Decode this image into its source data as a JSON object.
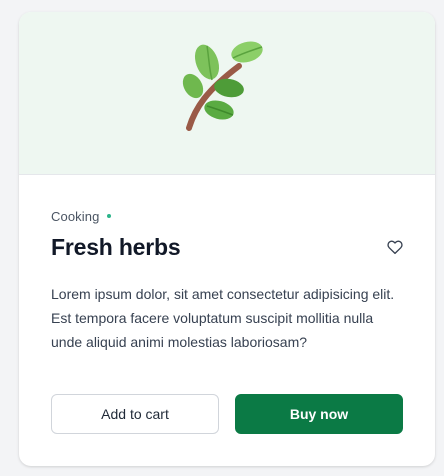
{
  "card": {
    "category": "Cooking",
    "title": "Fresh herbs",
    "description": "Lorem ipsum dolor, sit amet consectetur adipisicing elit. Est tempora facere voluptatum suscipit mollitia nulla unde aliquid animi molestias laboriosam?",
    "media_icon": "herb-sprig-icon",
    "favorite_icon": "heart-outline-icon"
  },
  "actions": {
    "add_to_cart_label": "Add to cart",
    "buy_now_label": "Buy now"
  },
  "colors": {
    "media_background": "#eef7f1",
    "category_dot": "#2bb48a",
    "primary_button": "#0b7a45",
    "title_text": "#111827"
  }
}
